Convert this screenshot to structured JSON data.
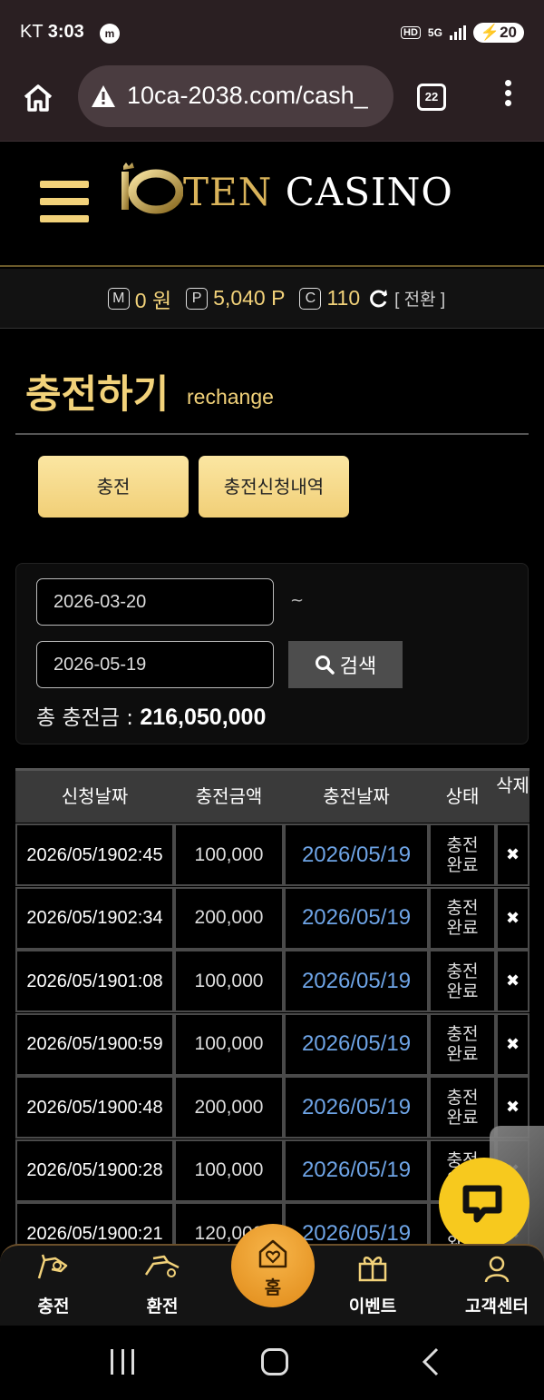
{
  "status_bar": {
    "carrier": "KT",
    "time": "3:03",
    "app_badge": "m",
    "hd": "HD",
    "network": "5G",
    "battery": "20"
  },
  "browser": {
    "url": "10ca-2038.com/cash_",
    "tab_count": "22"
  },
  "site": {
    "logo_ten": "TEN",
    "logo_casino": "CASINO"
  },
  "balance": {
    "money_label": "M",
    "money_value": "0 원",
    "point_label": "P",
    "point_value": "5,040 P",
    "coin_label": "C",
    "coin_value": "110",
    "switch_label": "[ 전환 ]"
  },
  "page": {
    "title": "충전하기",
    "subtitle": "rechange"
  },
  "tabs": [
    {
      "label": "충전"
    },
    {
      "label": "충전신청내역"
    }
  ],
  "search": {
    "start_date": "2026-03-20",
    "end_date": "2026-05-19",
    "separator": "~",
    "search_label": "검색",
    "total_label": "총 충전금 :",
    "total_value": "216,050,000"
  },
  "table": {
    "headers": {
      "request_date": "신청날짜",
      "amount": "충전금액",
      "charge_date": "충전날짜",
      "status": "상태",
      "delete": "삭제"
    },
    "rows": [
      {
        "date": "2026/05/19",
        "time": "02:45",
        "amount": "100,000",
        "charge_date": "2026/05/19",
        "status": "충전완료"
      },
      {
        "date": "2026/05/19",
        "time": "02:34",
        "amount": "200,000",
        "charge_date": "2026/05/19",
        "status": "충전완료"
      },
      {
        "date": "2026/05/19",
        "time": "01:08",
        "amount": "100,000",
        "charge_date": "2026/05/19",
        "status": "충전완료"
      },
      {
        "date": "2026/05/19",
        "time": "00:59",
        "amount": "100,000",
        "charge_date": "2026/05/19",
        "status": "충전완료"
      },
      {
        "date": "2026/05/19",
        "time": "00:48",
        "amount": "200,000",
        "charge_date": "2026/05/19",
        "status": "충전완료"
      },
      {
        "date": "2026/05/19",
        "time": "00:28",
        "amount": "100,000",
        "charge_date": "2026/05/19",
        "status": "충전완료"
      },
      {
        "date": "2026/05/19",
        "time": "00:21",
        "amount": "120,000",
        "charge_date": "2026/05/19",
        "status": "충전완료"
      }
    ]
  },
  "bottom_nav": {
    "charge": "충전",
    "exchange": "환전",
    "home": "홈",
    "event": "이벤트",
    "support": "고객센터"
  },
  "colors": {
    "gold": "#f2d27a",
    "link_blue": "#6ea4e6",
    "status_bg": "#2a1f22",
    "home_orange": "#e08a18",
    "chat_yellow": "#f7c91e"
  }
}
